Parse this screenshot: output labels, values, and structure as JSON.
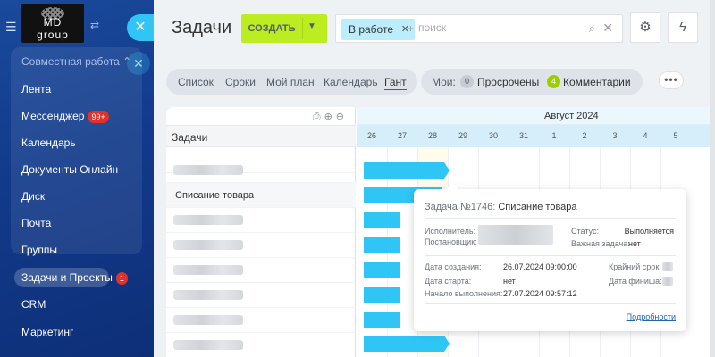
{
  "sidebar": {
    "logo": {
      "line1": "MD",
      "line2": "group"
    },
    "section_label": "Совместная работа",
    "items": [
      {
        "label": "Лента"
      },
      {
        "label": "Мессенджер",
        "badge": "99+"
      },
      {
        "label": "Календарь"
      },
      {
        "label": "Документы Онлайн"
      },
      {
        "label": "Диск"
      },
      {
        "label": "Почта"
      },
      {
        "label": "Группы"
      },
      {
        "label": "Задачи и Проекты",
        "badge": "1",
        "active": true
      },
      {
        "label": "CRM"
      },
      {
        "label": "Маркетинг"
      }
    ]
  },
  "header": {
    "title": "Задачи",
    "create_label": "СОЗДАТЬ",
    "filter_chip": "В работе",
    "search_placeholder": "поиск"
  },
  "views": {
    "tabs": [
      "Список",
      "Сроки",
      "Мой план",
      "Календарь",
      "Гант"
    ],
    "active_tab": "Гант"
  },
  "counters": {
    "label": "Мои:",
    "items": [
      {
        "count": "0",
        "label": "Просрочены",
        "color": "#c6ccd2"
      },
      {
        "count": "4",
        "label": "Комментарии",
        "color": "#9dcf00"
      }
    ]
  },
  "gantt": {
    "tasks_header": "Задачи",
    "month_label": "Август 2024",
    "days": [
      "26",
      "27",
      "28",
      "29",
      "30",
      "31",
      "1",
      "2",
      "3",
      "4",
      "5"
    ],
    "highlight_day": "28",
    "rows": [
      {
        "label": ""
      },
      {
        "label": "Списание товара",
        "selected": true
      },
      {
        "label": ""
      },
      {
        "label": ""
      },
      {
        "label": ""
      },
      {
        "label": ""
      },
      {
        "label": ""
      },
      {
        "label": ""
      }
    ]
  },
  "popup": {
    "number": "Задача №1746:",
    "name": "Списание товара",
    "assignee_label": "Исполнитель:",
    "creator_label": "Постановщик:",
    "status_label": "Статус:",
    "status_value": "Выполняется",
    "important_label": "Важная задача:",
    "important_value": "нет",
    "created_label": "Дата создания:",
    "created_value": "26.07.2024 09:00:00",
    "deadline_label": "Крайний срок:",
    "start_label": "Дата старта:",
    "start_value": "нет",
    "finish_label": "Дата финиша:",
    "exec_label": "Начало выполнения:",
    "exec_value": "27.07.2024 09:57:12",
    "details_link": "Подробности"
  },
  "colors": {
    "accent": "#2fc6f6",
    "create_button": "#bbed21",
    "sidebar": "#123a8a",
    "badge": "#e0312b"
  }
}
